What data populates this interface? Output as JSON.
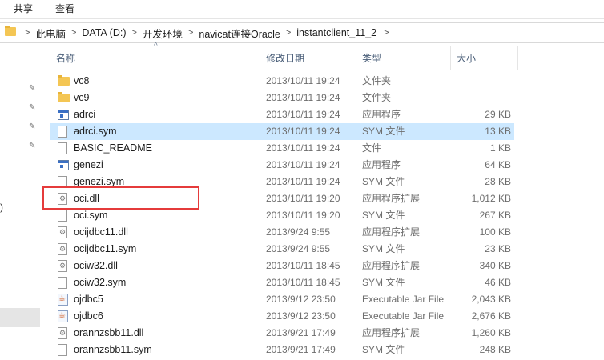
{
  "ribbon": {
    "tabs": [
      "共享",
      "查看"
    ]
  },
  "address": {
    "crumbs": [
      "此电脑",
      "DATA (D:)",
      "开发环境",
      "navicat连接Oracle",
      "instantclient_11_2"
    ]
  },
  "nav": {
    "paren": ")"
  },
  "columns": {
    "name": "名称",
    "date": "修改日期",
    "type": "类型",
    "size": "大小"
  },
  "sort_arrow": "^",
  "files": [
    {
      "name": "vc8",
      "date": "2013/10/11 19:24",
      "type": "文件夹",
      "size": "",
      "icon": "folder-icon"
    },
    {
      "name": "vc9",
      "date": "2013/10/11 19:24",
      "type": "文件夹",
      "size": "",
      "icon": "folder-icon"
    },
    {
      "name": "adrci",
      "date": "2013/10/11 19:24",
      "type": "应用程序",
      "size": "29 KB",
      "icon": "application-icon"
    },
    {
      "name": "adrci.sym",
      "date": "2013/10/11 19:24",
      "type": "SYM 文件",
      "size": "13 KB",
      "icon": "file-icon"
    },
    {
      "name": "BASIC_README",
      "date": "2013/10/11 19:24",
      "type": "文件",
      "size": "1 KB",
      "icon": "file-icon"
    },
    {
      "name": "genezi",
      "date": "2013/10/11 19:24",
      "type": "应用程序",
      "size": "64 KB",
      "icon": "application-icon"
    },
    {
      "name": "genezi.sym",
      "date": "2013/10/11 19:24",
      "type": "SYM 文件",
      "size": "28 KB",
      "icon": "file-icon"
    },
    {
      "name": "oci.dll",
      "date": "2013/10/11 19:20",
      "type": "应用程序扩展",
      "size": "1,012 KB",
      "icon": "dll-icon"
    },
    {
      "name": "oci.sym",
      "date": "2013/10/11 19:20",
      "type": "SYM 文件",
      "size": "267 KB",
      "icon": "file-icon"
    },
    {
      "name": "ocijdbc11.dll",
      "date": "2013/9/24 9:55",
      "type": "应用程序扩展",
      "size": "100 KB",
      "icon": "dll-icon"
    },
    {
      "name": "ocijdbc11.sym",
      "date": "2013/9/24 9:55",
      "type": "SYM 文件",
      "size": "23 KB",
      "icon": "dll-icon"
    },
    {
      "name": "ociw32.dll",
      "date": "2013/10/11 18:45",
      "type": "应用程序扩展",
      "size": "340 KB",
      "icon": "dll-icon"
    },
    {
      "name": "ociw32.sym",
      "date": "2013/10/11 18:45",
      "type": "SYM 文件",
      "size": "46 KB",
      "icon": "file-icon"
    },
    {
      "name": "ojdbc5",
      "date": "2013/9/12 23:50",
      "type": "Executable Jar File",
      "size": "2,043 KB",
      "icon": "jar-icon"
    },
    {
      "name": "ojdbc6",
      "date": "2013/9/12 23:50",
      "type": "Executable Jar File",
      "size": "2,676 KB",
      "icon": "jar-icon"
    },
    {
      "name": "orannzsbb11.dll",
      "date": "2013/9/21 17:49",
      "type": "应用程序扩展",
      "size": "1,260 KB",
      "icon": "dll-icon"
    },
    {
      "name": "orannzsbb11.sym",
      "date": "2013/9/21 17:49",
      "type": "SYM 文件",
      "size": "248 KB",
      "icon": "file-icon"
    }
  ],
  "selected_index": 3,
  "highlighted_file": "oci.dll",
  "colors": {
    "highlight_box": "#e53b3b",
    "selection": "#cce8ff",
    "header_text": "#4c607a"
  }
}
